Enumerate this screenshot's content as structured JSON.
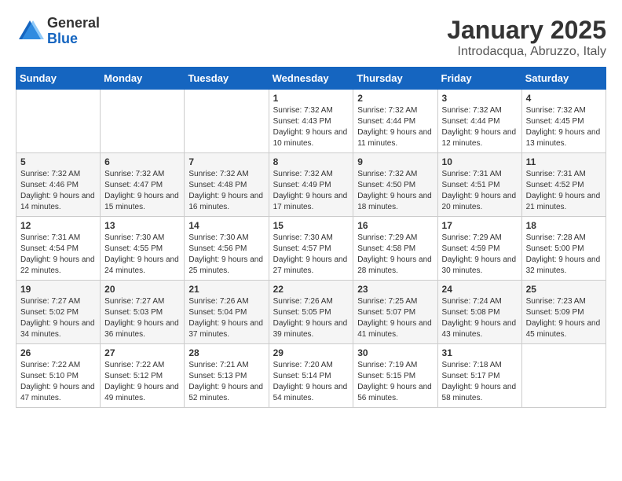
{
  "header": {
    "logo_general": "General",
    "logo_blue": "Blue",
    "month_title": "January 2025",
    "location": "Introdacqua, Abruzzo, Italy"
  },
  "days_of_week": [
    "Sunday",
    "Monday",
    "Tuesday",
    "Wednesday",
    "Thursday",
    "Friday",
    "Saturday"
  ],
  "weeks": [
    [
      {
        "day": "",
        "info": ""
      },
      {
        "day": "",
        "info": ""
      },
      {
        "day": "",
        "info": ""
      },
      {
        "day": "1",
        "info": "Sunrise: 7:32 AM\nSunset: 4:43 PM\nDaylight: 9 hours and 10 minutes."
      },
      {
        "day": "2",
        "info": "Sunrise: 7:32 AM\nSunset: 4:44 PM\nDaylight: 9 hours and 11 minutes."
      },
      {
        "day": "3",
        "info": "Sunrise: 7:32 AM\nSunset: 4:44 PM\nDaylight: 9 hours and 12 minutes."
      },
      {
        "day": "4",
        "info": "Sunrise: 7:32 AM\nSunset: 4:45 PM\nDaylight: 9 hours and 13 minutes."
      }
    ],
    [
      {
        "day": "5",
        "info": "Sunrise: 7:32 AM\nSunset: 4:46 PM\nDaylight: 9 hours and 14 minutes."
      },
      {
        "day": "6",
        "info": "Sunrise: 7:32 AM\nSunset: 4:47 PM\nDaylight: 9 hours and 15 minutes."
      },
      {
        "day": "7",
        "info": "Sunrise: 7:32 AM\nSunset: 4:48 PM\nDaylight: 9 hours and 16 minutes."
      },
      {
        "day": "8",
        "info": "Sunrise: 7:32 AM\nSunset: 4:49 PM\nDaylight: 9 hours and 17 minutes."
      },
      {
        "day": "9",
        "info": "Sunrise: 7:32 AM\nSunset: 4:50 PM\nDaylight: 9 hours and 18 minutes."
      },
      {
        "day": "10",
        "info": "Sunrise: 7:31 AM\nSunset: 4:51 PM\nDaylight: 9 hours and 20 minutes."
      },
      {
        "day": "11",
        "info": "Sunrise: 7:31 AM\nSunset: 4:52 PM\nDaylight: 9 hours and 21 minutes."
      }
    ],
    [
      {
        "day": "12",
        "info": "Sunrise: 7:31 AM\nSunset: 4:54 PM\nDaylight: 9 hours and 22 minutes."
      },
      {
        "day": "13",
        "info": "Sunrise: 7:30 AM\nSunset: 4:55 PM\nDaylight: 9 hours and 24 minutes."
      },
      {
        "day": "14",
        "info": "Sunrise: 7:30 AM\nSunset: 4:56 PM\nDaylight: 9 hours and 25 minutes."
      },
      {
        "day": "15",
        "info": "Sunrise: 7:30 AM\nSunset: 4:57 PM\nDaylight: 9 hours and 27 minutes."
      },
      {
        "day": "16",
        "info": "Sunrise: 7:29 AM\nSunset: 4:58 PM\nDaylight: 9 hours and 28 minutes."
      },
      {
        "day": "17",
        "info": "Sunrise: 7:29 AM\nSunset: 4:59 PM\nDaylight: 9 hours and 30 minutes."
      },
      {
        "day": "18",
        "info": "Sunrise: 7:28 AM\nSunset: 5:00 PM\nDaylight: 9 hours and 32 minutes."
      }
    ],
    [
      {
        "day": "19",
        "info": "Sunrise: 7:27 AM\nSunset: 5:02 PM\nDaylight: 9 hours and 34 minutes."
      },
      {
        "day": "20",
        "info": "Sunrise: 7:27 AM\nSunset: 5:03 PM\nDaylight: 9 hours and 36 minutes."
      },
      {
        "day": "21",
        "info": "Sunrise: 7:26 AM\nSunset: 5:04 PM\nDaylight: 9 hours and 37 minutes."
      },
      {
        "day": "22",
        "info": "Sunrise: 7:26 AM\nSunset: 5:05 PM\nDaylight: 9 hours and 39 minutes."
      },
      {
        "day": "23",
        "info": "Sunrise: 7:25 AM\nSunset: 5:07 PM\nDaylight: 9 hours and 41 minutes."
      },
      {
        "day": "24",
        "info": "Sunrise: 7:24 AM\nSunset: 5:08 PM\nDaylight: 9 hours and 43 minutes."
      },
      {
        "day": "25",
        "info": "Sunrise: 7:23 AM\nSunset: 5:09 PM\nDaylight: 9 hours and 45 minutes."
      }
    ],
    [
      {
        "day": "26",
        "info": "Sunrise: 7:22 AM\nSunset: 5:10 PM\nDaylight: 9 hours and 47 minutes."
      },
      {
        "day": "27",
        "info": "Sunrise: 7:22 AM\nSunset: 5:12 PM\nDaylight: 9 hours and 49 minutes."
      },
      {
        "day": "28",
        "info": "Sunrise: 7:21 AM\nSunset: 5:13 PM\nDaylight: 9 hours and 52 minutes."
      },
      {
        "day": "29",
        "info": "Sunrise: 7:20 AM\nSunset: 5:14 PM\nDaylight: 9 hours and 54 minutes."
      },
      {
        "day": "30",
        "info": "Sunrise: 7:19 AM\nSunset: 5:15 PM\nDaylight: 9 hours and 56 minutes."
      },
      {
        "day": "31",
        "info": "Sunrise: 7:18 AM\nSunset: 5:17 PM\nDaylight: 9 hours and 58 minutes."
      },
      {
        "day": "",
        "info": ""
      }
    ]
  ]
}
